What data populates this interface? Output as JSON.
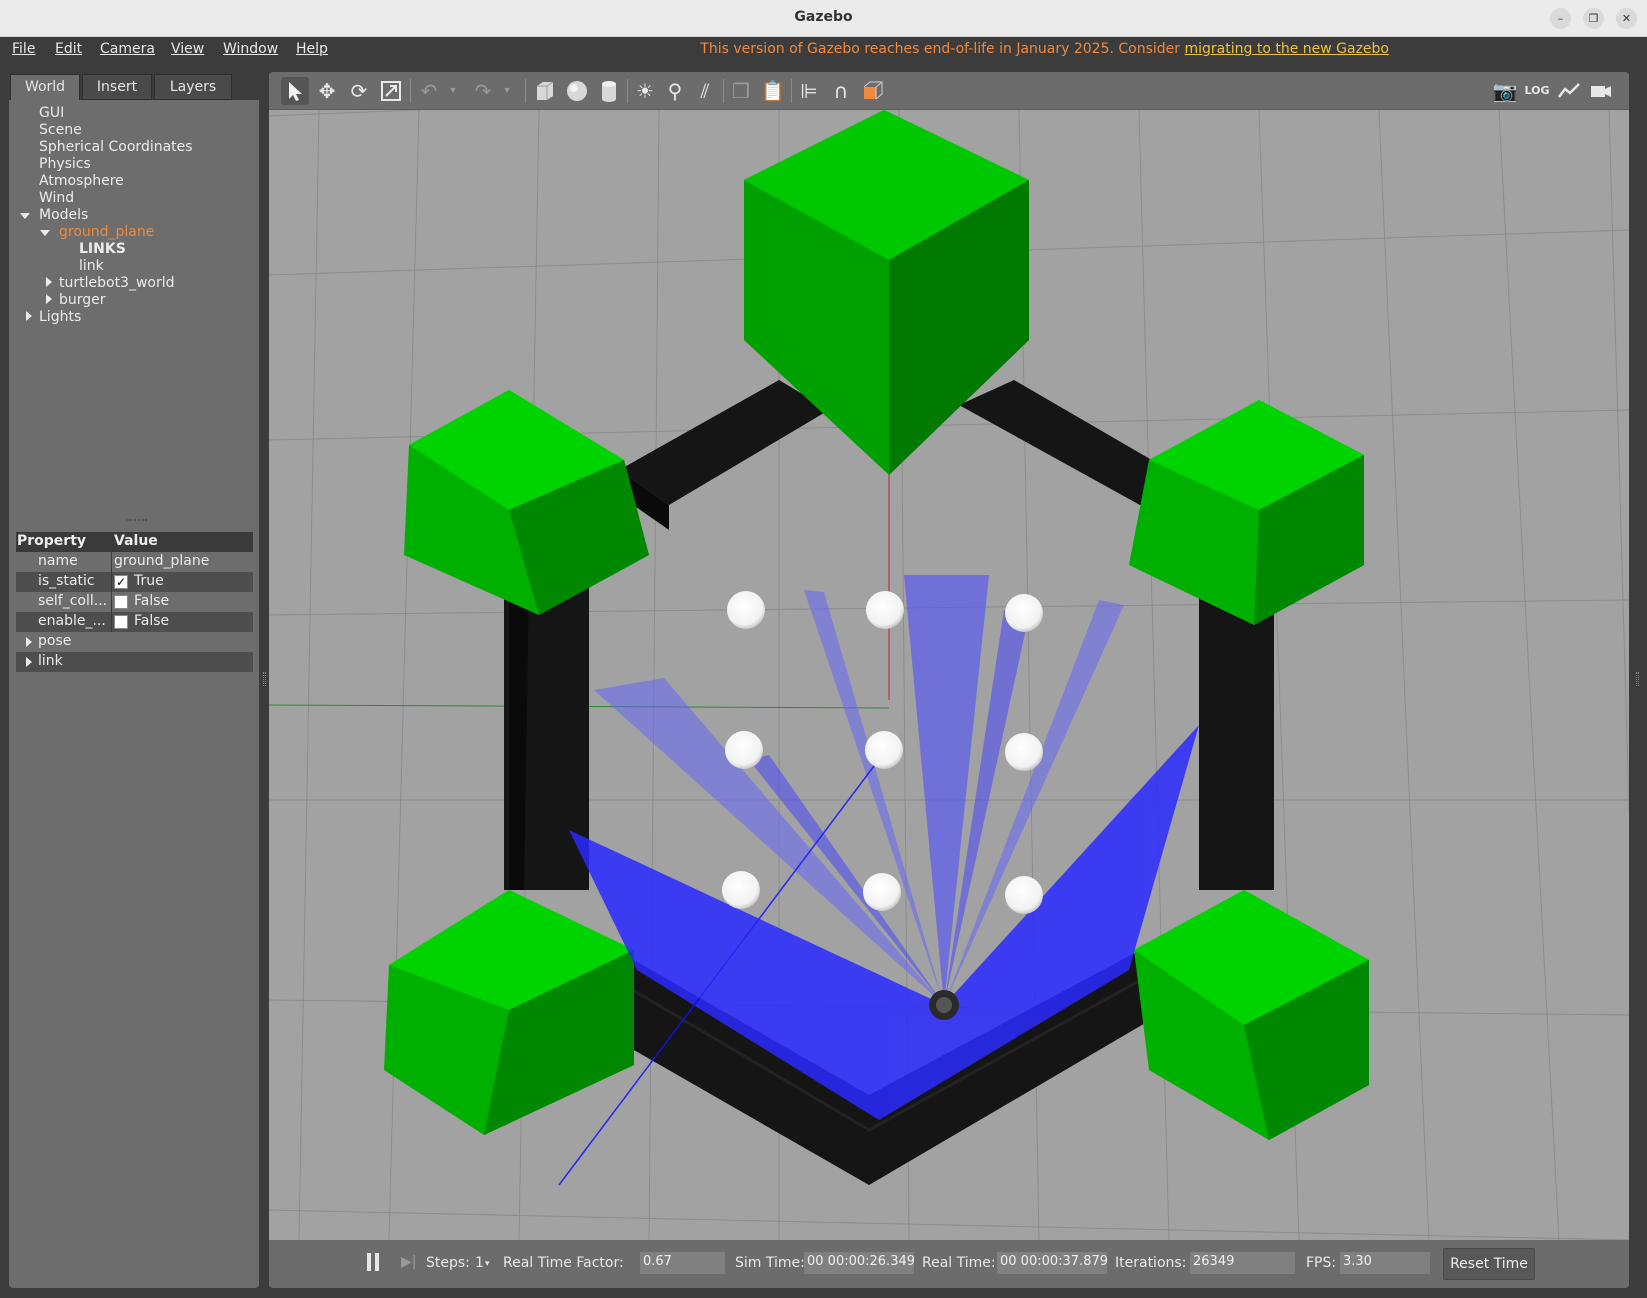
{
  "window": {
    "title": "Gazebo"
  },
  "menu": {
    "items": [
      "File",
      "Edit",
      "Camera",
      "View",
      "Window",
      "Help"
    ],
    "notice": "This version of Gazebo reaches end-of-life in January 2025. Consider ",
    "notice_link": "migrating to the new Gazebo"
  },
  "left_panel": {
    "tabs": [
      "World",
      "Insert",
      "Layers"
    ],
    "tree": {
      "gui": "GUI",
      "scene": "Scene",
      "spherical": "Spherical Coordinates",
      "physics": "Physics",
      "atmosphere": "Atmosphere",
      "wind": "Wind",
      "models": "Models",
      "ground_plane": "ground_plane",
      "links_header": "LINKS",
      "link": "link",
      "turtlebot3_world": "turtlebot3_world",
      "burger": "burger",
      "lights": "Lights"
    },
    "properties": {
      "header_property": "Property",
      "header_value": "Value",
      "name_key": "name",
      "name_value": "ground_plane",
      "is_static_key": "is_static",
      "is_static_value": "True",
      "is_static_checked": true,
      "self_coll_key": "self_coll...",
      "self_coll_value": "False",
      "enable_key": "enable_...",
      "enable_value": "False",
      "pose": "pose",
      "link": "link"
    }
  },
  "toolbar": {
    "left_icons": [
      "select-mode",
      "translate-mode",
      "rotate-mode",
      "scale-mode",
      "undo",
      "undo-history",
      "redo",
      "redo-history",
      "box-shape",
      "sphere-shape",
      "cylinder-shape",
      "point-light",
      "spot-light",
      "directional-light",
      "copy",
      "paste",
      "align",
      "snap",
      "change-view"
    ],
    "right_icons": [
      "screenshot",
      "log",
      "plot",
      "record-video"
    ]
  },
  "bottom_bar": {
    "steps_label": "Steps:",
    "steps_value": "1",
    "rtf_label": "Real Time Factor:",
    "rtf_value": "0.67",
    "sim_time_label": "Sim Time:",
    "sim_time_value": "00 00:00:26.349",
    "real_time_label": "Real Time:",
    "real_time_value": "00 00:00:37.879",
    "iterations_label": "Iterations:",
    "iterations_value": "26349",
    "fps_label": "FPS:",
    "fps_value": "3.30",
    "reset_label": "Reset Time"
  },
  "colors": {
    "accent_selected": "#f08a3e",
    "notice_link": "#f0c23a",
    "obstacle_green": "#00c800",
    "wall_black": "#151515",
    "laser_blue": "#2020ff",
    "ground_gray": "#a2a2a2"
  }
}
